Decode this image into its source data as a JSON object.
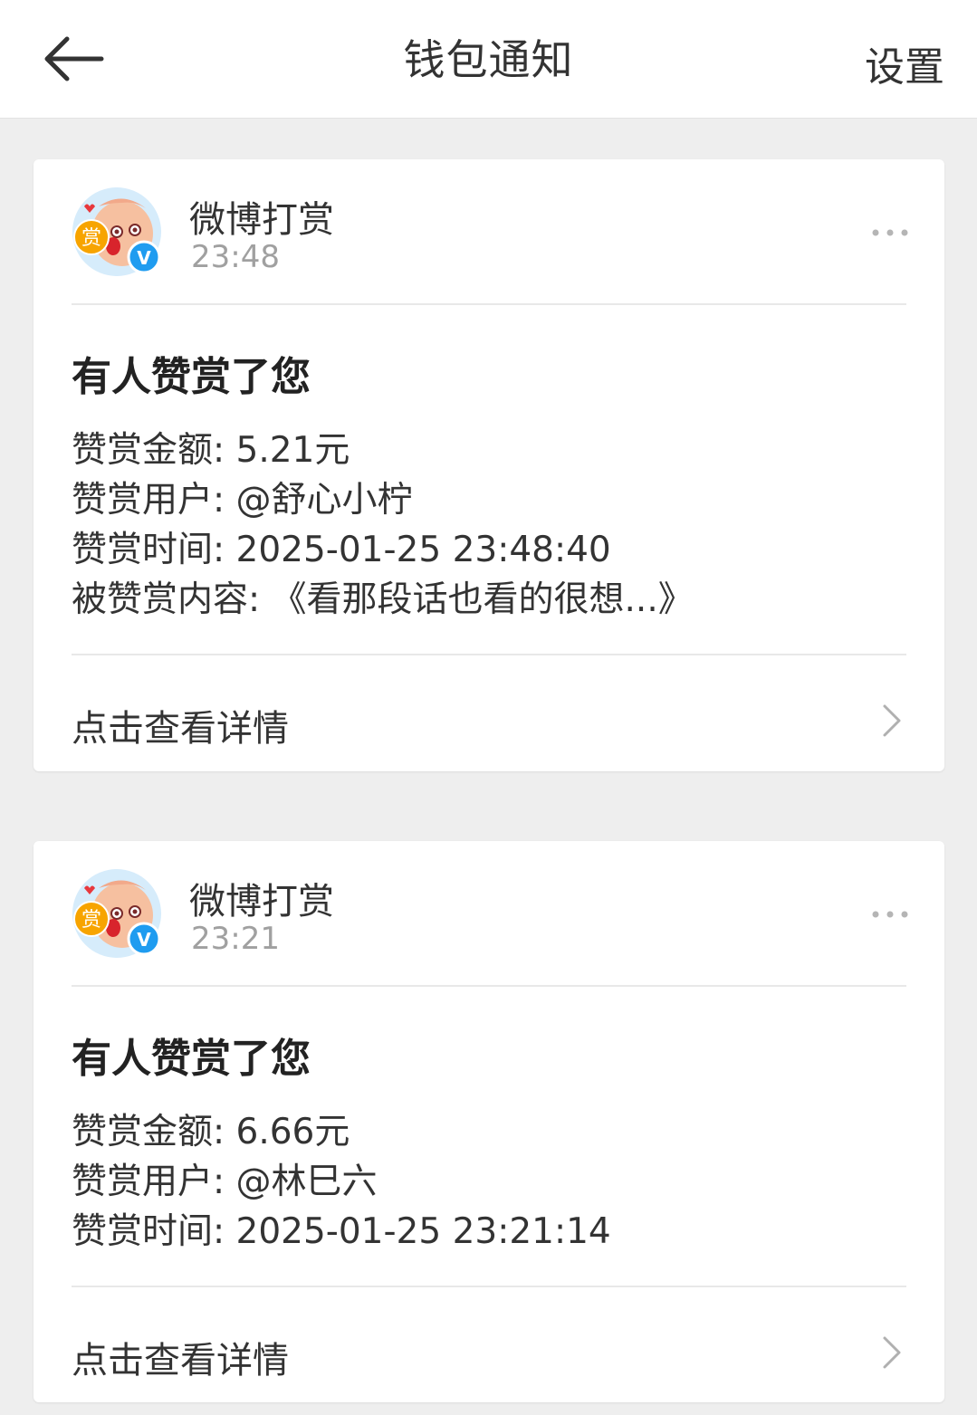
{
  "header": {
    "title": "钱包通知",
    "settings_label": "设置",
    "back_icon": "arrow-left-icon"
  },
  "colors": {
    "background": "#eeeeee",
    "card": "#ffffff",
    "timestamp": "#a0a0a0",
    "verified_badge": "#1f9cf0",
    "reward_badge": "#f7a400"
  },
  "notifications": [
    {
      "sender": "微博打赏",
      "time": "23:48",
      "avatar_badge": "赏",
      "verified_mark": "V",
      "headline": "有人赞赏了您",
      "details": [
        "赞赏金额: 5.21元",
        "赞赏用户: @舒心小柠",
        "赞赏时间: 2025-01-25 23:48:40",
        "被赞赏内容: 《看那段话也看的很想...》"
      ],
      "link_label": "点击查看详情"
    },
    {
      "sender": "微博打赏",
      "time": "23:21",
      "avatar_badge": "赏",
      "verified_mark": "V",
      "headline": "有人赞赏了您",
      "details": [
        "赞赏金额: 6.66元",
        "赞赏用户: @林巳六",
        "赞赏时间: 2025-01-25 23:21:14"
      ],
      "link_label": "点击查看详情"
    }
  ]
}
